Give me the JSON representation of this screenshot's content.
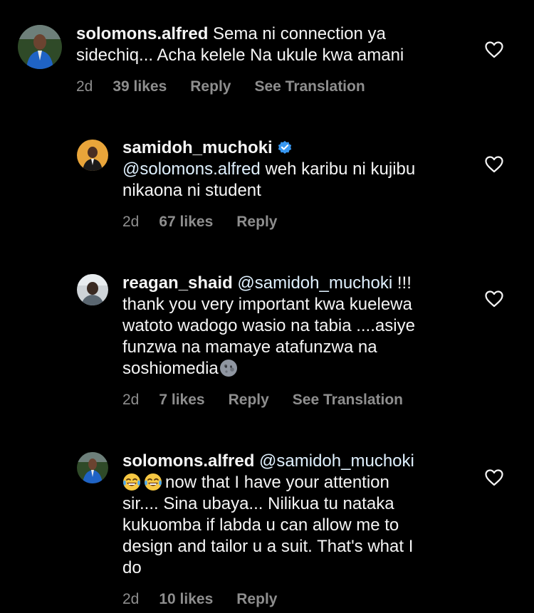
{
  "colors": {
    "background": "#000000",
    "text": "#f5f5f5",
    "meta": "#8e8e8e",
    "verified": "#3897f0"
  },
  "comments": [
    {
      "username": "solomons.alfred",
      "text_lines": [
        " Sema ni connection ya",
        "sidechiq... Acha kelele Na ukule kwa amani"
      ],
      "time": "2d",
      "likes": "39 likes",
      "reply": "Reply",
      "translation": "See Translation",
      "avatar_icon": "profile-photo"
    },
    {
      "username": "samidoh_muchoki",
      "verified": true,
      "mention": "@solomons.alfred",
      "text_lines": [
        " weh karibu ni kujibu",
        "nikaona ni student"
      ],
      "time": "2d",
      "likes": "67 likes",
      "reply": "Reply",
      "avatar_icon": "profile-photo"
    },
    {
      "username": "reagan_shaid",
      "mention": "@samidoh_muchoki",
      "text_lines": [
        " !!!",
        "thank you very important kwa kuelewa",
        "watoto wadogo wasio na tabia ....asiye",
        "funzwa na mamaye atafunzwa na",
        "soshiomedia"
      ],
      "emoji_end": "new-moon-face-emoji",
      "time": "2d",
      "likes": "7 likes",
      "reply": "Reply",
      "translation": "See Translation",
      "avatar_icon": "profile-photo"
    },
    {
      "username": "solomons.alfred",
      "mention": "@samidoh_muchoki",
      "emoji_start": [
        "tears-of-joy-emoji",
        "tears-of-joy-emoji"
      ],
      "text_lines": [
        "now that I have your attention",
        "sir.... Sina ubaya... Nilikua tu nataka",
        "kukuomba if labda u can allow me to",
        "design and tailor u a suit. That's what I",
        "do"
      ],
      "time": "2d",
      "likes": "10 likes",
      "reply": "Reply",
      "avatar_icon": "profile-photo"
    }
  ],
  "icons": {
    "like": "heart-outline-icon",
    "verified": "verified-badge-icon"
  }
}
